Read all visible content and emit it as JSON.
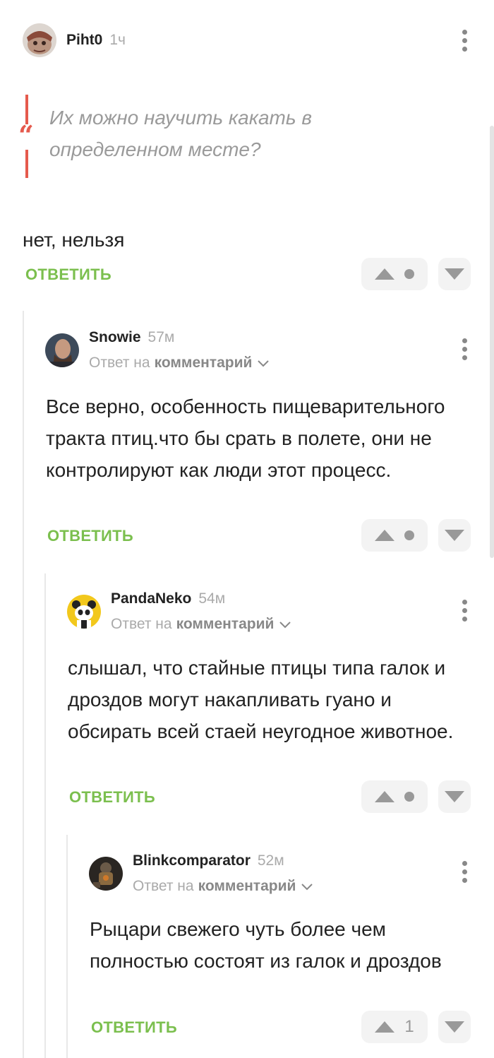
{
  "colors": {
    "accent_green": "#7bbf4e",
    "quote_red": "#e55a4d",
    "muted": "#aaaaaa"
  },
  "comments": [
    {
      "author": "Piht0",
      "time": "1ч",
      "quote": "Их можно научить какать в определенном месте?",
      "text": "нет, нельзя",
      "reply_label": "ОТВЕТИТЬ",
      "rating": "",
      "avatar_icon": "avatar-piht0"
    },
    {
      "author": "Snowie",
      "time": "57м",
      "reply_to_prefix": "Ответ на",
      "reply_to_target": "комментарий",
      "text": "Все верно, особенность пищеварительного тракта птиц.что бы срать в полете, они не контролируют как люди этот процесс.",
      "reply_label": "ОТВЕТИТЬ",
      "rating": "",
      "avatar_icon": "avatar-snowie"
    },
    {
      "author": "PandaNeko",
      "time": "54м",
      "reply_to_prefix": "Ответ на",
      "reply_to_target": "комментарий",
      "text": "слышал, что стайные птицы типа галок и дроздов могут накапливать гуано и обсирать всей стаей неугодное животное.",
      "reply_label": "ОТВЕТИТЬ",
      "rating": "",
      "avatar_icon": "avatar-pandaneko"
    },
    {
      "author": "Blinkcomparator",
      "time": "52м",
      "reply_to_prefix": "Ответ на",
      "reply_to_target": "комментарий",
      "text": "Рыцари свежего чуть более чем полностью состоят из галок и дроздов",
      "reply_label": "ОТВЕТИТЬ",
      "rating": "1",
      "avatar_icon": "avatar-blinkcomparator"
    }
  ]
}
